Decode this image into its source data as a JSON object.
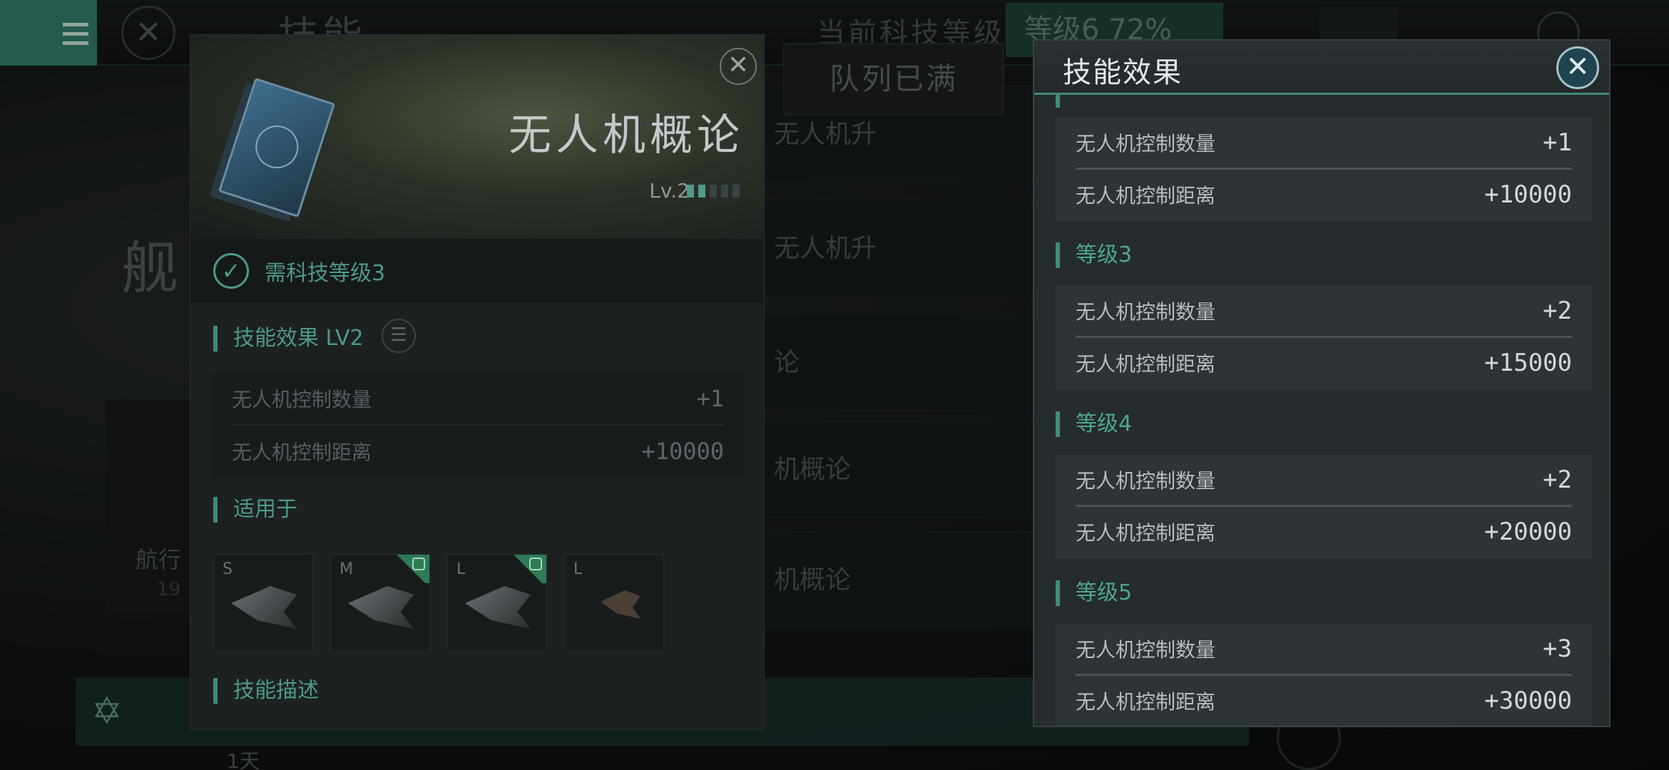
{
  "background": {
    "top_title": "技能",
    "top_label": "当前科技等级",
    "top_level": "等级6 72%",
    "side_title": "舰",
    "side_card_text": "航行",
    "side_card_num": "19",
    "bottom_day": "1天",
    "mid_items": [
      "无人机升",
      "无人机升",
      "论",
      "机概论",
      "机概论"
    ],
    "queue_full": "队列已满"
  },
  "detail": {
    "title": "无人机概论",
    "level_label": "Lv.2",
    "level_current": 2,
    "level_max": 5,
    "requirement": "需科技等级3",
    "effect_title": "技能效果 LV2",
    "effects": [
      {
        "label": "无人机控制数量",
        "value": "+1"
      },
      {
        "label": "无人机控制距离",
        "value": "+10000"
      }
    ],
    "applicable_title": "适用于",
    "ships": [
      {
        "size": "S",
        "flag": false
      },
      {
        "size": "M",
        "flag": true
      },
      {
        "size": "L",
        "flag": true
      },
      {
        "size": "L",
        "flag": false
      }
    ],
    "description_title": "技能描述"
  },
  "effects_panel": {
    "title": "技能效果",
    "levels": [
      {
        "name": "",
        "rows": [
          {
            "label": "无人机控制数量",
            "value": "+1"
          },
          {
            "label": "无人机控制距离",
            "value": "+10000"
          }
        ]
      },
      {
        "name": "等级3",
        "rows": [
          {
            "label": "无人机控制数量",
            "value": "+2"
          },
          {
            "label": "无人机控制距离",
            "value": "+15000"
          }
        ]
      },
      {
        "name": "等级4",
        "rows": [
          {
            "label": "无人机控制数量",
            "value": "+2"
          },
          {
            "label": "无人机控制距离",
            "value": "+20000"
          }
        ]
      },
      {
        "name": "等级5",
        "rows": [
          {
            "label": "无人机控制数量",
            "value": "+3"
          },
          {
            "label": "无人机控制距离",
            "value": "+30000"
          }
        ]
      }
    ]
  },
  "colors": {
    "accent": "#3e8c7a",
    "accent_text": "#4d9987"
  },
  "icons": {
    "menu": "hamburger-icon",
    "close": "close-icon",
    "check": "check-icon",
    "list": "list-icon"
  }
}
